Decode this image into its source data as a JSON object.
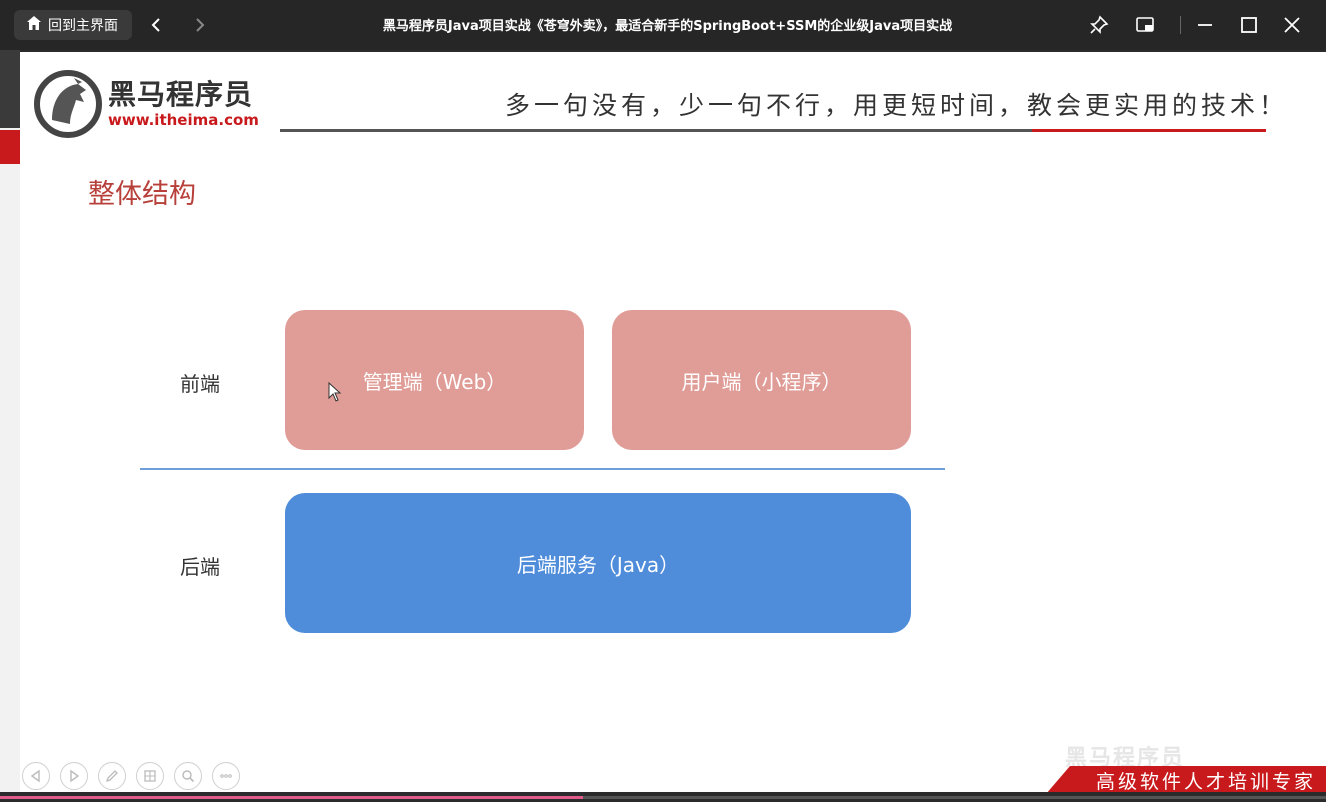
{
  "window": {
    "home_label": "回到主界面",
    "title": "黑马程序员Java项目实战《苍穹外卖》，最适合新手的SpringBoot+SSM的企业级Java项目实战"
  },
  "slide": {
    "logo_cn": "黑马程序员",
    "logo_url": "www.itheima.com",
    "slogan": "多一句没有，少一句不行，用更短时间，教会更实用的技术！",
    "section_title": "整体结构",
    "frontend_label": "前端",
    "backend_label": "后端",
    "admin_box": "管理端（Web）",
    "user_box": "用户端（小程序）",
    "backend_box": "后端服务（Java）",
    "watermark": "黑马程序员",
    "footer_banner": "高级软件人才培训专家"
  },
  "player": {
    "progress_fraction": 0.44
  },
  "colors": {
    "brand_red": "#c8191c",
    "frontend_box": "#e09c96",
    "backend_box": "#4f8ddb",
    "section_title": "#b8403b"
  }
}
